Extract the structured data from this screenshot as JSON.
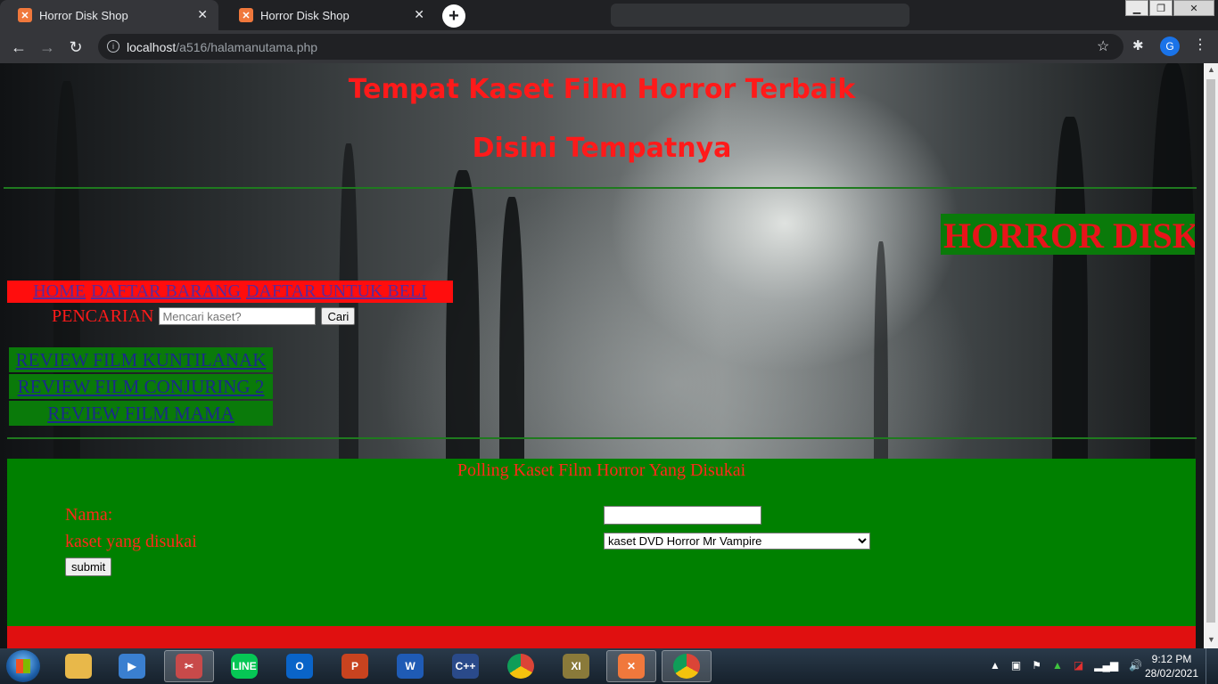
{
  "browser": {
    "tabs": [
      {
        "title": "Horror Disk Shop",
        "active": false
      },
      {
        "title": "Horror Disk Shop",
        "active": true
      }
    ],
    "url_host": "localhost",
    "url_path": "/a516/halamanutama.php",
    "profile_initial": "G"
  },
  "page": {
    "title_line1": "Tempat Kaset Film Horror Terbaik",
    "title_line2": "Disini Tempatnya",
    "marquee_text": "HORROR DISK SHOP",
    "nav": [
      "HOME",
      "DAFTAR BARANG",
      "DAFTAR UNTUK BELI"
    ],
    "search": {
      "label": "PENCARIAN",
      "placeholder": "Mencari kaset?",
      "button": "Cari"
    },
    "reviews": [
      "REVIEW FILM KUNTILANAK",
      "REVIEW FILM CONJURING 2",
      "REVIEW FILM MAMA"
    ],
    "poll": {
      "title": "Polling Kaset Film Horror Yang Disukai",
      "name_label": "Nama:",
      "kaset_label": "kaset yang disukai",
      "name_value": "",
      "selected_option": "kaset DVD Horror Mr Vampire",
      "submit": "submit"
    },
    "colors": {
      "title_red": "#ff1a1a",
      "nav_bg": "#ff0d0d",
      "review_bg": "#0a7a0a",
      "poll_bg": "#008000"
    }
  },
  "taskbar": {
    "apps": [
      "file-explorer",
      "media-player",
      "snipping-tool",
      "line",
      "outlook",
      "powerpoint",
      "word",
      "dev-cpp",
      "chrome",
      "rik-xi",
      "xampp",
      "chrome-profile"
    ],
    "time": "9:12 PM",
    "date": "28/02/2021"
  }
}
